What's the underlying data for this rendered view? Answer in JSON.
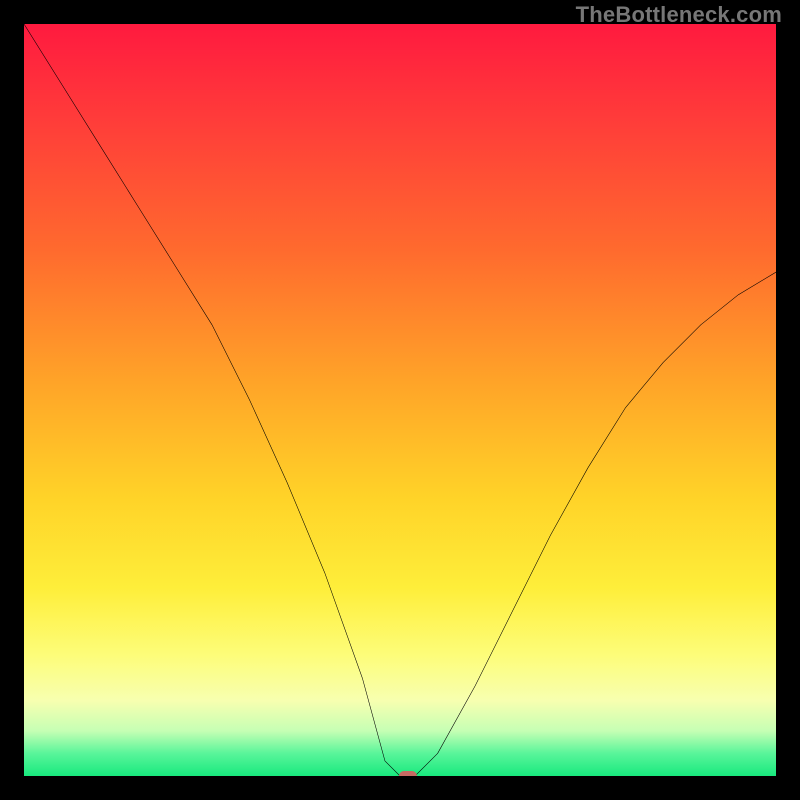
{
  "watermark": "TheBottleneck.com",
  "chart_data": {
    "type": "line",
    "title": "",
    "xlabel": "",
    "ylabel": "",
    "xlim": [
      0,
      100
    ],
    "ylim": [
      0,
      100
    ],
    "grid": false,
    "background": "rainbow-gradient-red-to-green",
    "series": [
      {
        "name": "bottleneck-curve",
        "x": [
          0,
          5,
          10,
          15,
          20,
          25,
          30,
          35,
          40,
          45,
          48,
          50,
          52,
          55,
          60,
          65,
          70,
          75,
          80,
          85,
          90,
          95,
          100
        ],
        "y": [
          100,
          92,
          84,
          76,
          68,
          60,
          50,
          39,
          27,
          13,
          2,
          0,
          0,
          3,
          12,
          22,
          32,
          41,
          49,
          55,
          60,
          64,
          67
        ]
      }
    ],
    "marker": {
      "x": 51,
      "y": 0,
      "color": "#c66a63"
    },
    "gradient_stops": [
      {
        "pos": 0,
        "color": "#ff1a3f"
      },
      {
        "pos": 12,
        "color": "#ff3a3a"
      },
      {
        "pos": 30,
        "color": "#ff6a2e"
      },
      {
        "pos": 48,
        "color": "#ffa528"
      },
      {
        "pos": 63,
        "color": "#ffd328"
      },
      {
        "pos": 75,
        "color": "#feee3a"
      },
      {
        "pos": 84,
        "color": "#fdfd7a"
      },
      {
        "pos": 90,
        "color": "#f7ffb0"
      },
      {
        "pos": 94,
        "color": "#c6ffb4"
      },
      {
        "pos": 97,
        "color": "#59f59a"
      },
      {
        "pos": 100,
        "color": "#18e97e"
      }
    ]
  }
}
